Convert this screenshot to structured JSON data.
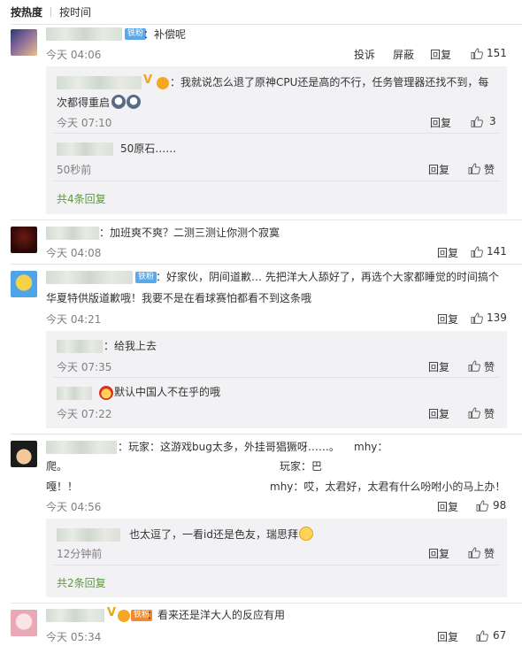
{
  "tabs": {
    "hot": "按热度",
    "time": "按时间"
  },
  "actions": {
    "report": "投诉",
    "block": "屏蔽",
    "reply": "回复",
    "like": "赞"
  },
  "badges": {
    "iron_fan": "铁粉"
  },
  "comments": [
    {
      "text": "：补偿呢",
      "time": "今天 04:06",
      "likes": "151",
      "replies": [
        {
          "text_line1": "：我就说怎么退了原神CPU还是高的不行，任务管理器还找不到，每",
          "text_line2": "次都得重启",
          "time": "今天 07:10",
          "likes": "3"
        },
        {
          "text": "50原石……",
          "time": "50秒前",
          "likes": "赞"
        }
      ],
      "more": "共4条回复"
    },
    {
      "text": "：加班爽不爽？二测三测让你测个寂寞",
      "time": "今天 04:08",
      "likes": "141"
    },
    {
      "text_line1": "：好家伙，阴间道歉… 先把洋大人舔好了，再选个大家都睡觉的时间搞个",
      "text_line2": "华夏特供版道歉哦！我要不是在看球赛怕都看不到这条哦",
      "time": "今天 04:21",
      "likes": "139",
      "replies": [
        {
          "text": "：给我上去",
          "time": "今天 07:35",
          "likes": "赞"
        },
        {
          "text": "默认中国人不在乎的哦",
          "time": "今天 07:22",
          "likes": "赞"
        }
      ]
    },
    {
      "text_a": "：玩家：这游戏bug太多，外挂哥猖獗呀……。",
      "text_b": "mhy：",
      "text_c": "爬。",
      "text_d": "玩家：巴",
      "text_e": "嘎！！",
      "text_f": "mhy：哎，太君好，太君有什么吩咐小的马上办！",
      "time": "今天 04:56",
      "likes": "98",
      "replies": [
        {
          "text": "也太逗了，一看id还是色友，瑞思拜",
          "time": "12分钟前",
          "likes": "赞"
        }
      ],
      "more": "共2条回复"
    },
    {
      "text": "：看来还是洋大人的反应有用",
      "time": "今天 05:34",
      "likes": "67"
    }
  ],
  "icons": {
    "like": "thumbs-up-icon",
    "laugh": "laughing-emoji-icon",
    "husky": "husky-emoji-icon",
    "angry": "angry-emoji-icon"
  },
  "colors": {
    "link_green": "#5a9a3c",
    "badge_blue": "#59a8ec",
    "badge_orange": "#f3892e",
    "meta_gray": "#808080",
    "sub_bg": "#f2f2f5"
  }
}
